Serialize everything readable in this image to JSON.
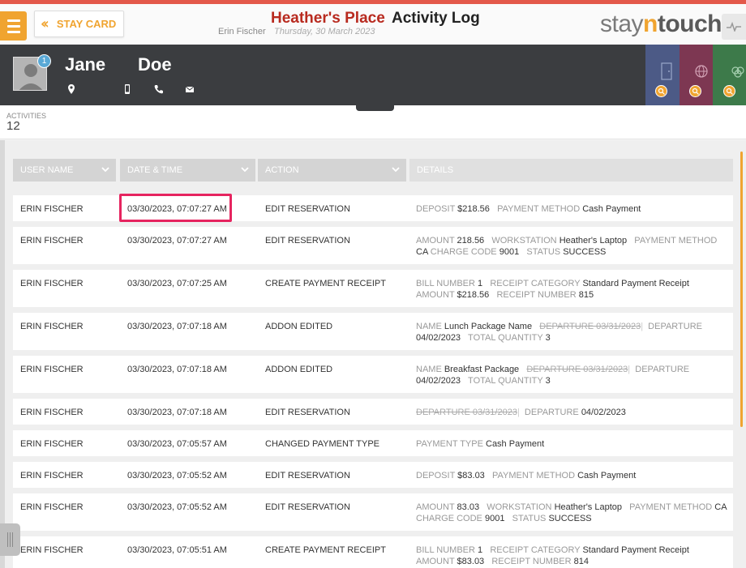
{
  "header": {
    "stay_card_label": "STAY CARD",
    "hotel_name": "Heather's Place",
    "page_title": "Activity Log",
    "user_name": "Erin Fischer",
    "business_date": "Thursday, 30 March 2023",
    "logo": {
      "part1": "stay",
      "part2": "n",
      "part3": "touch"
    }
  },
  "guest": {
    "first_name": "Jane",
    "last_name": "Doe",
    "badge_count": "1"
  },
  "activities": {
    "label": "ACTIVITIES",
    "count": "12"
  },
  "columns": {
    "user_name": "USER NAME",
    "date_time": "DATE & TIME",
    "action": "ACTION",
    "details": "DETAILS"
  },
  "colors": {
    "accent": "#f0a430",
    "hotel_name": "#b82a1f",
    "guest_bar": "#3b3d40",
    "highlight": "#e6245f"
  },
  "rows": [
    {
      "user": "ERIN FISCHER",
      "datetime": "03/30/2023, 07:07:27 AM",
      "action": "EDIT RESERVATION",
      "d": {
        "k1": "DEPOSIT",
        "v1": "$218.56",
        "k2": "PAYMENT METHOD",
        "v2": "Cash Payment"
      }
    },
    {
      "user": "ERIN FISCHER",
      "datetime": "03/30/2023, 07:07:27 AM",
      "action": "EDIT RESERVATION",
      "d": {
        "k1": "AMOUNT",
        "v1": "218.56",
        "k2": "WORKSTATION",
        "v2": "Heather's Laptop",
        "k3": "PAYMENT METHOD",
        "v3": "CA",
        "k4": "CHARGE CODE",
        "v4": "9001",
        "k5": "STATUS",
        "v5": "SUCCESS"
      }
    },
    {
      "user": "ERIN FISCHER",
      "datetime": "03/30/2023, 07:07:25 AM",
      "action": "CREATE PAYMENT RECEIPT",
      "d": {
        "k1": "BILL NUMBER",
        "v1": "1",
        "k2": "RECEIPT CATEGORY",
        "v2": "Standard Payment Receipt",
        "k3": "AMOUNT",
        "v3": "$218.56",
        "k4": "RECEIPT NUMBER",
        "v4": "815"
      }
    },
    {
      "user": "ERIN FISCHER",
      "datetime": "03/30/2023, 07:07:18 AM",
      "action": "ADDON EDITED",
      "d": {
        "k1": "NAME",
        "v1": "Lunch Package Name",
        "old": "DEPARTURE 03/31/2023",
        "k2": "DEPARTURE",
        "v2": "04/02/2023",
        "k3": "TOTAL QUANTITY",
        "v3": "3"
      }
    },
    {
      "user": "ERIN FISCHER",
      "datetime": "03/30/2023, 07:07:18 AM",
      "action": "ADDON EDITED",
      "d": {
        "k1": "NAME",
        "v1": "Breakfast Package",
        "old": "DEPARTURE 03/31/2023",
        "k2": "DEPARTURE",
        "v2": "04/02/2023",
        "k3": "TOTAL QUANTITY",
        "v3": "3"
      }
    },
    {
      "user": "ERIN FISCHER",
      "datetime": "03/30/2023, 07:07:18 AM",
      "action": "EDIT RESERVATION",
      "d": {
        "old": "DEPARTURE 03/31/2023",
        "k1": "DEPARTURE",
        "v1": "04/02/2023"
      }
    },
    {
      "user": "ERIN FISCHER",
      "datetime": "03/30/2023, 07:05:57 AM",
      "action": "CHANGED PAYMENT TYPE",
      "d": {
        "k1": "PAYMENT TYPE",
        "v1": "Cash Payment"
      }
    },
    {
      "user": "ERIN FISCHER",
      "datetime": "03/30/2023, 07:05:52 AM",
      "action": "EDIT RESERVATION",
      "d": {
        "k1": "DEPOSIT",
        "v1": "$83.03",
        "k2": "PAYMENT METHOD",
        "v2": "Cash Payment"
      }
    },
    {
      "user": "ERIN FISCHER",
      "datetime": "03/30/2023, 07:05:52 AM",
      "action": "EDIT RESERVATION",
      "d": {
        "k1": "AMOUNT",
        "v1": "83.03",
        "k2": "WORKSTATION",
        "v2": "Heather's Laptop",
        "k3": "PAYMENT METHOD",
        "v3": "CA",
        "k4": "CHARGE CODE",
        "v4": "9001",
        "k5": "STATUS",
        "v5": "SUCCESS"
      }
    },
    {
      "user": "ERIN FISCHER",
      "datetime": "03/30/2023, 07:05:51 AM",
      "action": "CREATE PAYMENT RECEIPT",
      "d": {
        "k1": "BILL NUMBER",
        "v1": "1",
        "k2": "RECEIPT CATEGORY",
        "v2": "Standard Payment Receipt",
        "k3": "AMOUNT",
        "v3": "$83.03",
        "k4": "RECEIPT NUMBER",
        "v4": "814"
      }
    }
  ]
}
